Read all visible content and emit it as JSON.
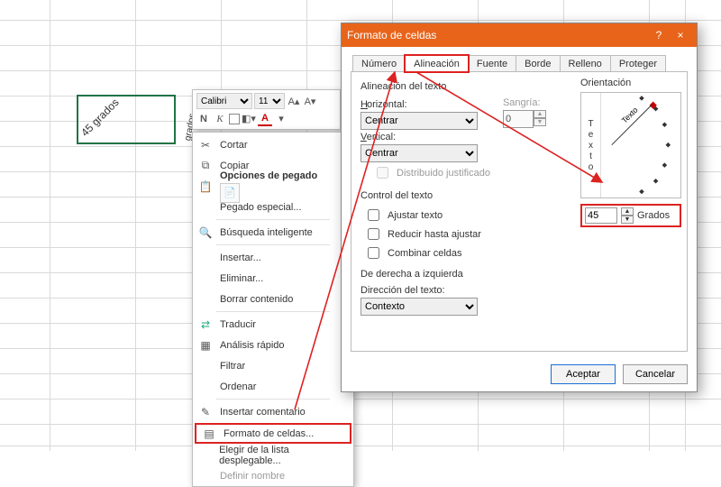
{
  "cell": {
    "text": "45 grados",
    "adjacent": "grados"
  },
  "minitoolbar": {
    "font": "Calibri",
    "size": "11",
    "toolA": "A"
  },
  "context_menu": {
    "cut": "Cortar",
    "copy": "Copiar",
    "paste_opts": "Opciones de pegado",
    "paste_special": "Pegado especial...",
    "smart_lookup": "Búsqueda inteligente",
    "insert": "Insertar...",
    "delete": "Eliminar...",
    "clear": "Borrar contenido",
    "translate": "Traducir",
    "quick_analysis": "Análisis rápido",
    "filter": "Filtrar",
    "sort": "Ordenar",
    "insert_comment": "Insertar comentario",
    "format_cells": "Formato de celdas...",
    "pick_list": "Elegir de la lista desplegable...",
    "define_name": "Definir nombre"
  },
  "dialog": {
    "title": "Formato de celdas",
    "help": "?",
    "close": "×",
    "tabs": {
      "number": "Número",
      "alignment": "Alineación",
      "font": "Fuente",
      "border": "Borde",
      "fill": "Relleno",
      "protect": "Proteger"
    },
    "text_align_group": "Alineación del texto",
    "horizontal_label": "Horizontal:",
    "horizontal_value": "Centrar",
    "vertical_label": "Vertical:",
    "vertical_value": "Centrar",
    "indent_label": "Sangría:",
    "indent_value": "0",
    "dist_just": "Distribuido justificado",
    "text_control_group": "Control del texto",
    "wrap": "Ajustar texto",
    "shrink": "Reducir hasta ajustar",
    "merge": "Combinar celdas",
    "rtl_group": "De derecha a izquierda",
    "text_dir_label": "Dirección del texto:",
    "text_dir_value": "Contexto",
    "orientation_label": "Orientación",
    "vert_text": "Texto",
    "diag_text": "Texto",
    "degrees_value": "45",
    "degrees_label": "Grados",
    "ok": "Aceptar",
    "cancel": "Cancelar"
  }
}
